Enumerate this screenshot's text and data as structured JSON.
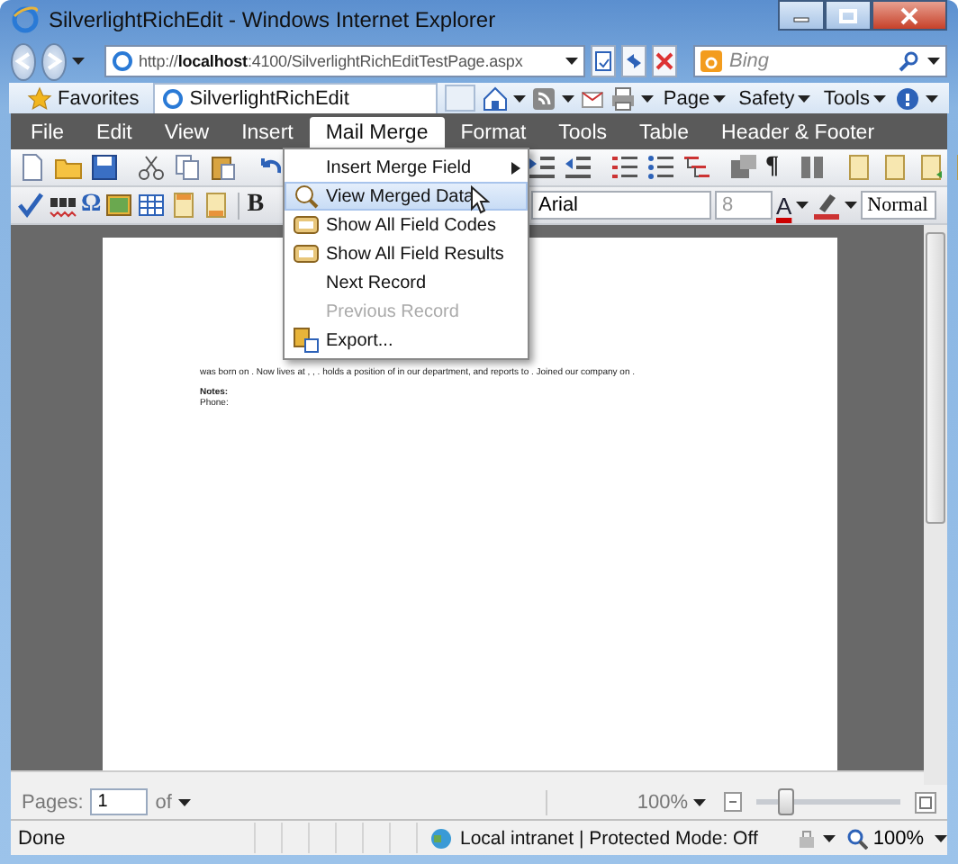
{
  "window": {
    "title": "SilverlightRichEdit - Windows Internet Explorer"
  },
  "address_bar": {
    "url": "http://**localhost**:4100/SilverlightRichEditTestPage.aspx"
  },
  "search": {
    "placeholder": "Bing"
  },
  "favorites": {
    "label": "Favorites"
  },
  "tab": {
    "title": "SilverlightRichEdit"
  },
  "command_bar": [
    "Page",
    "Safety",
    "Tools"
  ],
  "app_menu": [
    {
      "label": "File",
      "selected": false
    },
    {
      "label": "Edit",
      "selected": false
    },
    {
      "label": "View",
      "selected": false
    },
    {
      "label": "Insert",
      "selected": false
    },
    {
      "label": "Mail Merge",
      "selected": true
    },
    {
      "label": "Format",
      "selected": false
    },
    {
      "label": "Tools",
      "selected": false
    },
    {
      "label": "Table",
      "selected": false
    },
    {
      "label": "Header & Footer",
      "selected": false
    }
  ],
  "dropdown": [
    {
      "label": "Insert Merge Field",
      "kind": "submenu",
      "selected": false,
      "disabled": false
    },
    {
      "label": "View Merged Data",
      "kind": "command",
      "selected": true,
      "disabled": false
    },
    {
      "label": "Show All Field Codes",
      "kind": "command",
      "selected": false,
      "disabled": false
    },
    {
      "label": "Show All Field Results",
      "kind": "command",
      "selected": false,
      "disabled": false
    },
    {
      "label": "Next Record",
      "kind": "command",
      "selected": false,
      "disabled": false
    },
    {
      "label": "Previous Record",
      "kind": "command",
      "selected": false,
      "disabled": true
    },
    {
      "label": "Export...",
      "kind": "command",
      "selected": false,
      "disabled": false
    }
  ],
  "toolbar": {
    "show_marks": "¶",
    "symbol": "Ω",
    "bold": "B",
    "font": "Arial",
    "size": "8",
    "font_color": "A",
    "style": "Normal"
  },
  "document": {
    "paragraphs": [
      {
        "text": "was born on . Now lives at , , .  holds a position of  in our department,  and reports to . Joined our company on .",
        "bold": false
      }
    ],
    "fields": [
      {
        "text": "Notes:",
        "bold": true
      },
      {
        "text": "Phone:",
        "bold": false
      }
    ]
  },
  "pages": {
    "label": "Pages:",
    "value": "1",
    "of": "of"
  },
  "zoom": {
    "value": "100%",
    "level": 0.2
  },
  "status_bar": {
    "text": "Done",
    "zone": "Local intranet | Protected Mode: Off",
    "zoom": "100%"
  }
}
